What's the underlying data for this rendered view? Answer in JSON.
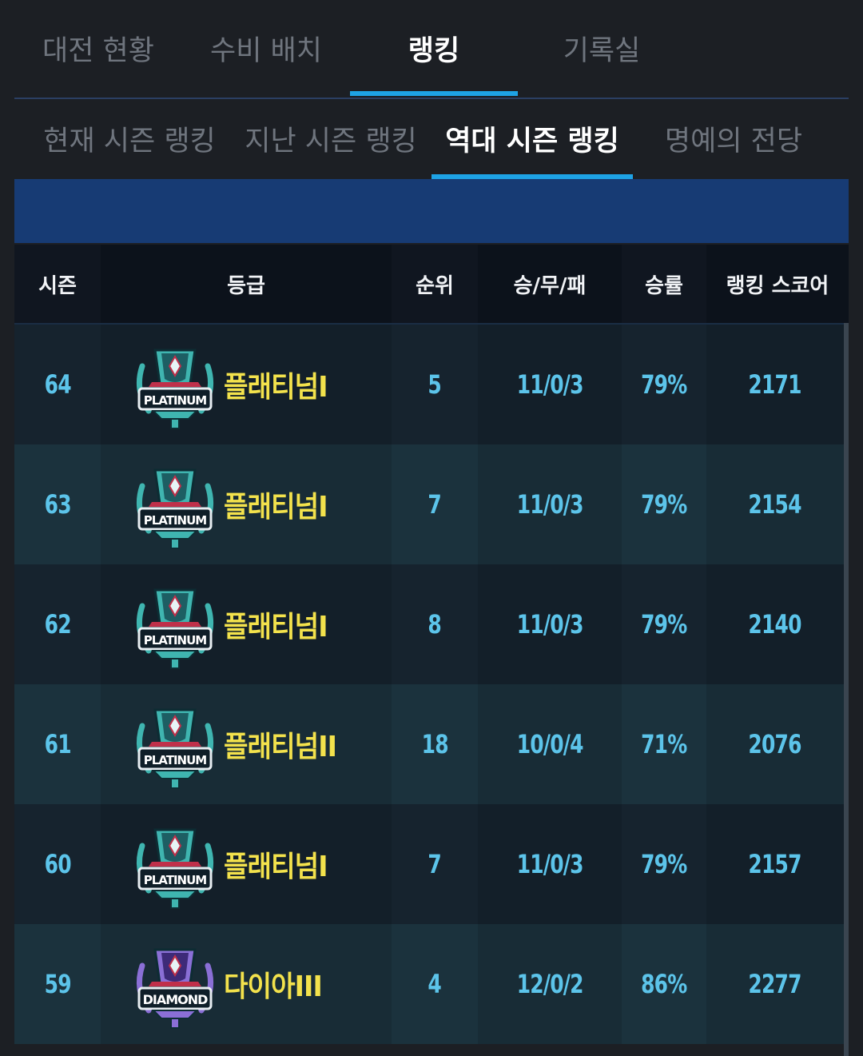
{
  "top_tabs": [
    "대전 현황",
    "수비 배치",
    "랭킹",
    "기록실"
  ],
  "sub_tabs": [
    "현재 시즌 랭킹",
    "지난 시즌 랭킹",
    "역대 시즌 랭킹",
    "명예의 전당"
  ],
  "columns": [
    "시즌",
    "등급",
    "순위",
    "승/무/패",
    "승률",
    "랭킹 스코어"
  ],
  "rows": [
    {
      "season": "64",
      "tier": "platinum",
      "badge_text": "PLATINUM",
      "grade": "플래티넘I",
      "rank": "5",
      "record": "11/0/3",
      "win_rate": "79%",
      "score": "2171"
    },
    {
      "season": "63",
      "tier": "platinum",
      "badge_text": "PLATINUM",
      "grade": "플래티넘I",
      "rank": "7",
      "record": "11/0/3",
      "win_rate": "79%",
      "score": "2154"
    },
    {
      "season": "62",
      "tier": "platinum",
      "badge_text": "PLATINUM",
      "grade": "플래티넘I",
      "rank": "8",
      "record": "11/0/3",
      "win_rate": "79%",
      "score": "2140"
    },
    {
      "season": "61",
      "tier": "platinum",
      "badge_text": "PLATINUM",
      "grade": "플래티넘II",
      "rank": "18",
      "record": "10/0/4",
      "win_rate": "71%",
      "score": "2076"
    },
    {
      "season": "60",
      "tier": "platinum",
      "badge_text": "PLATINUM",
      "grade": "플래티넘I",
      "rank": "7",
      "record": "11/0/3",
      "win_rate": "79%",
      "score": "2157"
    },
    {
      "season": "59",
      "tier": "diamond",
      "badge_text": "DIAMOND",
      "grade": "다이아III",
      "rank": "4",
      "record": "12/0/2",
      "win_rate": "86%",
      "score": "2277"
    }
  ],
  "colors": {
    "accent": "#1ea3e6",
    "grade_text": "#f3e24c",
    "value_text": "#5cc4ea",
    "platinum_badge": "#3fb5b0",
    "diamond_badge": "#8a6fd6"
  },
  "icons": {
    "platinum": "platinum-badge-icon",
    "diamond": "diamond-badge-icon"
  }
}
